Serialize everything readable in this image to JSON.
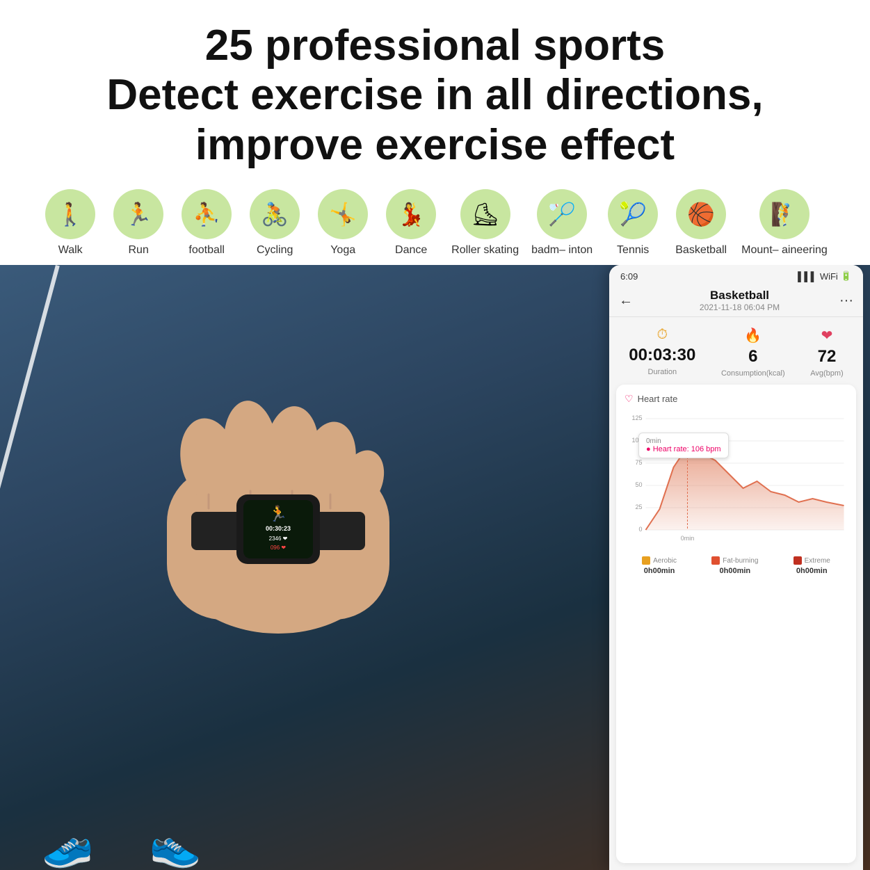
{
  "header": {
    "title_line1": "25 professional sports",
    "title_line2": "Detect exercise in all directions,",
    "title_line3": "improve exercise effect"
  },
  "sports": [
    {
      "label": "Walk",
      "icon": "🚶"
    },
    {
      "label": "Run",
      "icon": "🏃"
    },
    {
      "label": "football",
      "icon": "⛹"
    },
    {
      "label": "Cycling",
      "icon": "🚴"
    },
    {
      "label": "Yoga",
      "icon": "🤸"
    },
    {
      "label": "Dance",
      "icon": "💃"
    },
    {
      "label": "Roller\nskating",
      "icon": "⛸"
    },
    {
      "label": "badm–\ninton",
      "icon": "🏸"
    },
    {
      "label": "Tennis",
      "icon": "🎾"
    },
    {
      "label": "Basketball",
      "icon": "🏀"
    },
    {
      "label": "Mount–\naineering",
      "icon": "🧗"
    }
  ],
  "phone": {
    "status_time": "6:09",
    "nav_title": "Basketball",
    "nav_subtitle": "2021-11-18 06:04 PM",
    "stats": [
      {
        "icon": "⏱",
        "value": "00:03:30",
        "label": "Duration",
        "icon_color": "#e8a020"
      },
      {
        "icon": "🔥",
        "value": "6",
        "label": "Consumption(kcal)",
        "icon_color": "#e8a020"
      },
      {
        "icon": "❤",
        "value": "72",
        "label": "Avg(bpm)",
        "icon_color": "#e04060"
      }
    ],
    "chart": {
      "title": "Heart rate",
      "y_labels": [
        "125",
        "100",
        "75",
        "50",
        "25",
        "0"
      ],
      "x_label": "0min",
      "tooltip_title": "0min",
      "tooltip_value": "Heart rate: 106 bpm"
    },
    "legend": [
      {
        "label": "Aerobic",
        "value": "0h00min",
        "color": "#e8a020"
      },
      {
        "label": "Fat-burning",
        "value": "0h00min",
        "color": "#e05030"
      },
      {
        "label": "Extreme",
        "value": "0h00min",
        "color": "#c03020"
      }
    ]
  },
  "band": {
    "time": "00:30:23",
    "stat1": "2346 ❤",
    "stat2": "096 ❤"
  }
}
